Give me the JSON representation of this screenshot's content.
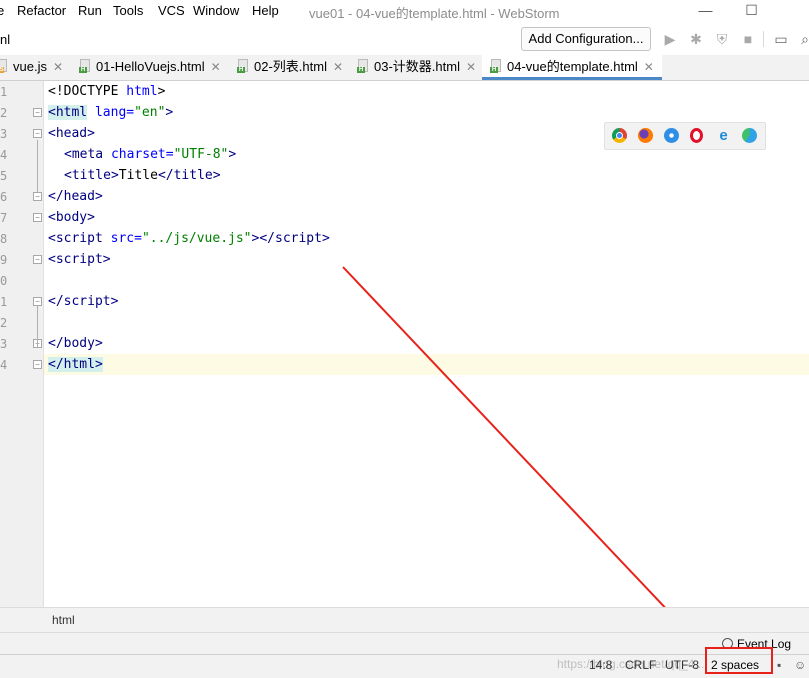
{
  "menu": [
    {
      "label": "e"
    },
    {
      "label": "Refactor"
    },
    {
      "label": "Run"
    },
    {
      "label": "Tools"
    },
    {
      "label": "VCS"
    },
    {
      "label": "Window"
    },
    {
      "label": "Help"
    }
  ],
  "window_title": "vue01 - 04-vue的template.html - WebStorm",
  "window_controls": {
    "minimize": "—",
    "maximize": "☐"
  },
  "toolbar": {
    "breadcrumb": "nl",
    "add_configuration": "Add Configuration..."
  },
  "tabs": [
    {
      "label": "vue.js",
      "icon": "js-file-icon"
    },
    {
      "label": "01-HelloVuejs.html",
      "icon": "html-file-icon"
    },
    {
      "label": "02-列表.html",
      "icon": "html-file-icon"
    },
    {
      "label": "03-计数器.html",
      "icon": "html-file-icon"
    },
    {
      "label": "04-vue的template.html",
      "icon": "html-file-icon",
      "active": true
    }
  ],
  "line_numbers": [
    "1",
    "2",
    "3",
    "4",
    "5",
    "6",
    "7",
    "8",
    "9",
    "0",
    "1",
    "2",
    "3",
    "4"
  ],
  "code": {
    "l1": {
      "a": "<!DOCTYPE ",
      "b": "html",
      "c": ">"
    },
    "l2": {
      "tag": "<html",
      "attr": " lang=",
      "val": "\"en\"",
      "end": ">"
    },
    "l3": {
      "tag": "<head",
      "end": ">"
    },
    "l4": {
      "tag": "<meta",
      "attr": " charset=",
      "val": "\"UTF-8\"",
      "end": ">"
    },
    "l5": {
      "tag1": "<title",
      "gt": ">",
      "text": "Title",
      "tag2": "</title",
      "end": ">"
    },
    "l6": {
      "tag": "</head",
      "end": ">"
    },
    "l7": {
      "tag": "<body",
      "end": ">"
    },
    "l8": {
      "tag": "<script",
      "attr": " src=",
      "val": "\"../js/vue.js\"",
      "gt": ">",
      "tag2": "</script",
      "end": ">"
    },
    "l9": {
      "tag": "<script",
      "end": ">"
    },
    "l11": {
      "tag": "</script",
      "end": ">"
    },
    "l13": {
      "tag": "</body",
      "end": ">"
    },
    "l14": {
      "tag": "</html",
      "end": ">"
    }
  },
  "browser_icons": [
    "chrome-icon",
    "firefox-icon",
    "safari-icon",
    "opera-icon",
    "ie-icon",
    "edge-icon"
  ],
  "footer_breadcrumb": "html",
  "event_log": "Event Log",
  "status": {
    "position": "14:8",
    "line_sep": "CRLF",
    "encoding": "UTF-8",
    "indent": "2 spaces"
  },
  "watermark": "https://blog.csdn.net/qq_4...",
  "annotation_color": "#e8221a"
}
